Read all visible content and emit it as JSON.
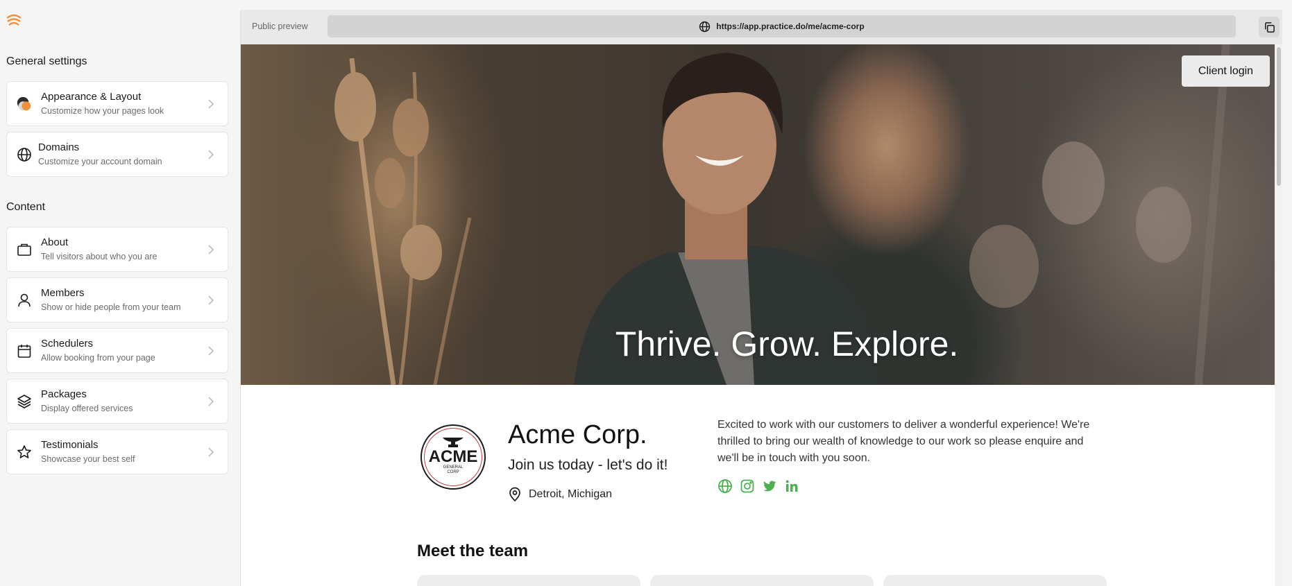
{
  "sidebar": {
    "general_title": "General settings",
    "content_title": "Content",
    "general_items": [
      {
        "title": "Appearance & Layout",
        "subtitle": "Customize how your pages look",
        "icon": "palette-icon"
      },
      {
        "title": "Domains",
        "subtitle": "Customize your account domain",
        "icon": "globe-icon"
      }
    ],
    "content_items": [
      {
        "title": "About",
        "subtitle": "Tell visitors about who you are",
        "icon": "briefcase-icon"
      },
      {
        "title": "Members",
        "subtitle": "Show or hide people from your team",
        "icon": "user-icon"
      },
      {
        "title": "Schedulers",
        "subtitle": "Allow booking from your page",
        "icon": "calendar-icon"
      },
      {
        "title": "Packages",
        "subtitle": "Display offered services",
        "icon": "layers-icon"
      },
      {
        "title": "Testimonials",
        "subtitle": "Showcase your best self",
        "icon": "star-icon"
      }
    ]
  },
  "preview": {
    "label": "Public preview",
    "url": "https://app.practice.do/me/acme-corp",
    "client_login": "Client login",
    "hero_heading": "Thrive. Grow. Explore.",
    "org": {
      "logo_text": "ACME",
      "logo_sub": "GENERAL CORP",
      "name": "Acme Corp.",
      "tagline": "Join us today - let's do it!",
      "location": "Detroit, Michigan",
      "description": "Excited to work with our customers to deliver a wonderful experience! We're thrilled to bring our wealth of knowledge to our work so please enquire and we'll be in touch with you soon."
    },
    "socials": [
      "globe-icon",
      "instagram-icon",
      "twitter-icon",
      "linkedin-icon"
    ],
    "team_title": "Meet the team"
  },
  "colors": {
    "accent_green": "#4caf50",
    "logo_orange": "#f0913a",
    "logo_red": "#c23a3a"
  }
}
